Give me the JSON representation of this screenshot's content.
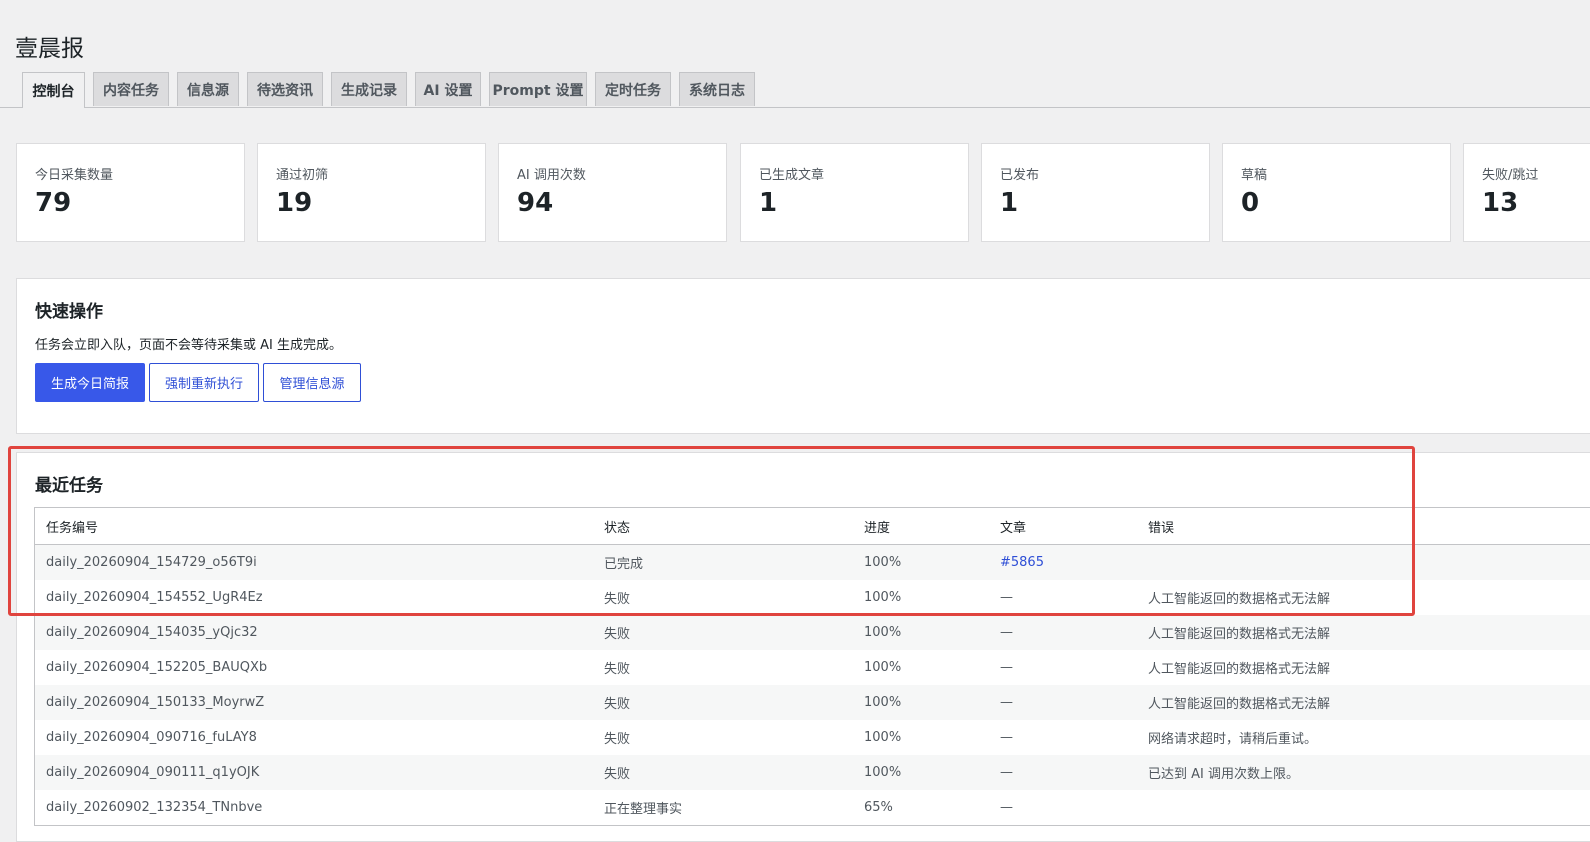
{
  "app": {
    "title": "壹晨报"
  },
  "tabs": [
    {
      "label": "控制台",
      "active": true
    },
    {
      "label": "内容任务",
      "active": false
    },
    {
      "label": "信息源",
      "active": false
    },
    {
      "label": "待选资讯",
      "active": false
    },
    {
      "label": "生成记录",
      "active": false
    },
    {
      "label": "AI 设置",
      "active": false
    },
    {
      "label": "Prompt 设置",
      "active": false
    },
    {
      "label": "定时任务",
      "active": false
    },
    {
      "label": "系统日志",
      "active": false
    }
  ],
  "stats": [
    {
      "label": "今日采集数量",
      "value": "79"
    },
    {
      "label": "通过初筛",
      "value": "19"
    },
    {
      "label": "AI 调用次数",
      "value": "94"
    },
    {
      "label": "已生成文章",
      "value": "1"
    },
    {
      "label": "已发布",
      "value": "1"
    },
    {
      "label": "草稿",
      "value": "0"
    },
    {
      "label": "失败/跳过",
      "value": "13"
    }
  ],
  "quick_actions": {
    "title": "快速操作",
    "description": "任务会立即入队，页面不会等待采集或 AI 生成完成。",
    "buttons": {
      "generate": "生成今日简报",
      "force_rerun": "强制重新执行",
      "manage_sources": "管理信息源"
    }
  },
  "recent_tasks": {
    "title": "最近任务",
    "columns": {
      "id": "任务编号",
      "status": "状态",
      "progress": "进度",
      "article": "文章",
      "error": "错误"
    },
    "rows": [
      {
        "id": "daily_20260904_154729_o56T9i",
        "status": "已完成",
        "progress": "100%",
        "article": "#5865",
        "error": ""
      },
      {
        "id": "daily_20260904_154552_UgR4Ez",
        "status": "失败",
        "progress": "100%",
        "article": "—",
        "error": "人工智能返回的数据格式无法解"
      },
      {
        "id": "daily_20260904_154035_yQjc32",
        "status": "失败",
        "progress": "100%",
        "article": "—",
        "error": "人工智能返回的数据格式无法解"
      },
      {
        "id": "daily_20260904_152205_BAUQXb",
        "status": "失败",
        "progress": "100%",
        "article": "—",
        "error": "人工智能返回的数据格式无法解"
      },
      {
        "id": "daily_20260904_150133_MoyrwZ",
        "status": "失败",
        "progress": "100%",
        "article": "—",
        "error": "人工智能返回的数据格式无法解"
      },
      {
        "id": "daily_20260904_090716_fuLAY8",
        "status": "失败",
        "progress": "100%",
        "article": "—",
        "error": "网络请求超时，请稍后重试。"
      },
      {
        "id": "daily_20260904_090111_q1yOJK",
        "status": "失败",
        "progress": "100%",
        "article": "—",
        "error": "已达到 AI 调用次数上限。"
      },
      {
        "id": "daily_20260902_132354_TNnbve",
        "status": "正在整理事实",
        "progress": "65%",
        "article": "—",
        "error": ""
      }
    ]
  },
  "colors": {
    "accent": "#3858e9",
    "highlight": "#e0443e",
    "background": "#f0f0f1"
  }
}
